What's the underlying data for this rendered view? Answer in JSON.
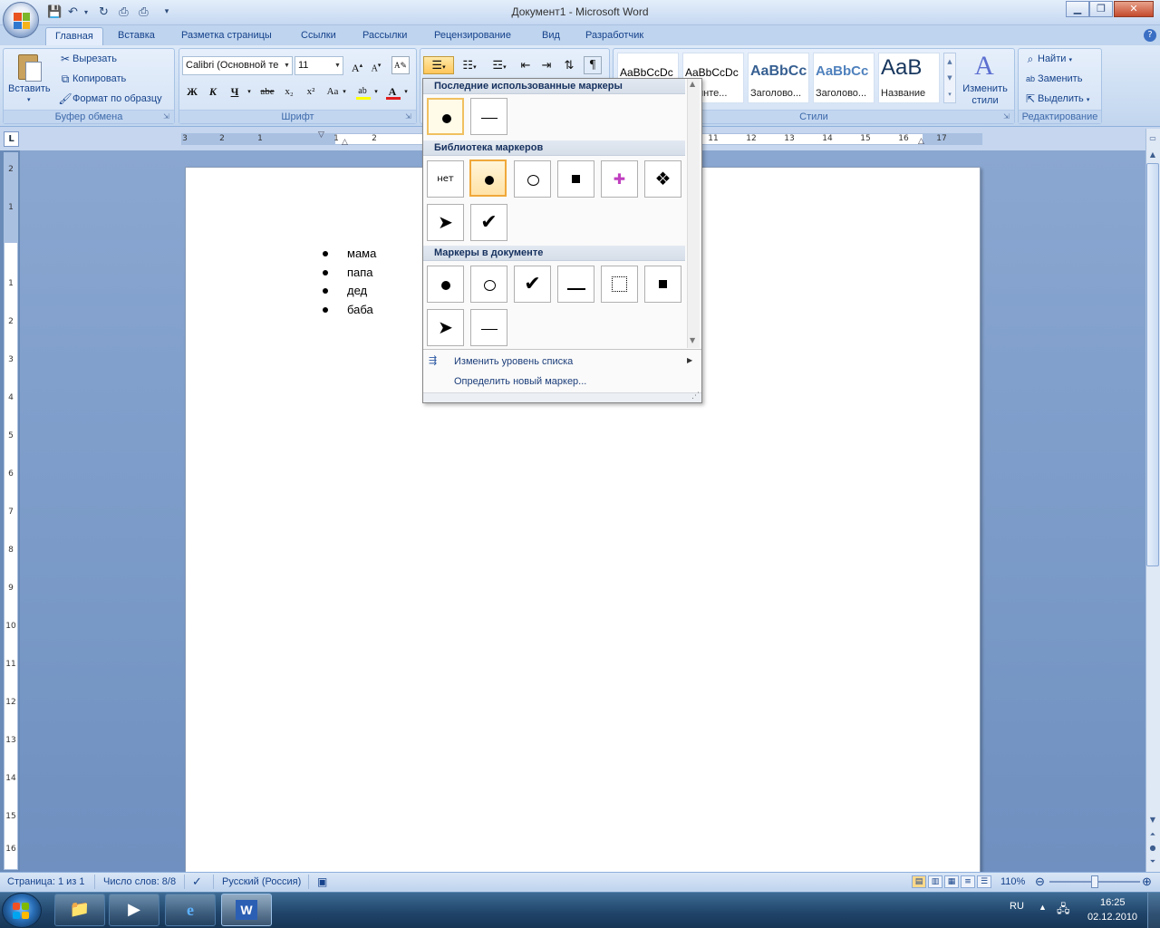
{
  "window": {
    "title": "Документ1 - Microsoft Word"
  },
  "tabs": [
    "Главная",
    "Вставка",
    "Разметка страницы",
    "Ссылки",
    "Рассылки",
    "Рецензирование",
    "Вид",
    "Разработчик"
  ],
  "clipboard": {
    "paste": "Вставить",
    "cut": "Вырезать",
    "copy": "Копировать",
    "format_painter": "Формат по образцу",
    "label": "Буфер обмена"
  },
  "font": {
    "name": "Calibri (Основной те",
    "size": "11",
    "label": "Шрифт",
    "bold": "Ж",
    "italic": "К",
    "underline": "Ч",
    "strike": "abe",
    "sub": "x₂",
    "sup": "x²",
    "case": "Aa"
  },
  "styles": {
    "label": "Стили",
    "items": [
      {
        "sample": "AaBbCcDc",
        "name": ""
      },
      {
        "sample": "AaBbCcDc",
        "name": "ез инте..."
      },
      {
        "sample": "AaBbCc",
        "name": "Заголово..."
      },
      {
        "sample": "AaBbCc",
        "name": "Заголово..."
      },
      {
        "sample": "AaB",
        "name": "Название"
      }
    ],
    "change_styles": "Изменить стили"
  },
  "editing": {
    "find": "Найти",
    "replace": "Заменить",
    "select": "Выделить",
    "label": "Редактирование"
  },
  "document": {
    "bullets": [
      "мама",
      "папа",
      "дед",
      "баба"
    ]
  },
  "bullet_menu": {
    "recent_header": "Последние использованные маркеры",
    "library_header": "Библиотека маркеров",
    "document_header": "Маркеры в документе",
    "none_label": "нет",
    "change_level": "Изменить уровень списка",
    "define_new": "Определить новый маркер..."
  },
  "ruler": {
    "h_ticks": [
      "3",
      "2",
      "1",
      "1",
      "2",
      "11",
      "12",
      "13",
      "14",
      "15",
      "16",
      "17"
    ],
    "v_ticks": [
      "2",
      "1",
      "1",
      "2",
      "3",
      "4",
      "5",
      "6",
      "7",
      "8",
      "9",
      "10",
      "11",
      "12",
      "13",
      "14",
      "15",
      "16"
    ]
  },
  "status": {
    "page": "Страница: 1 из 1",
    "words": "Число слов: 8/8",
    "language": "Русский (Россия)",
    "zoom": "110%"
  },
  "taskbar": {
    "lang": "RU",
    "time": "16:25",
    "date": "02.12.2010"
  }
}
